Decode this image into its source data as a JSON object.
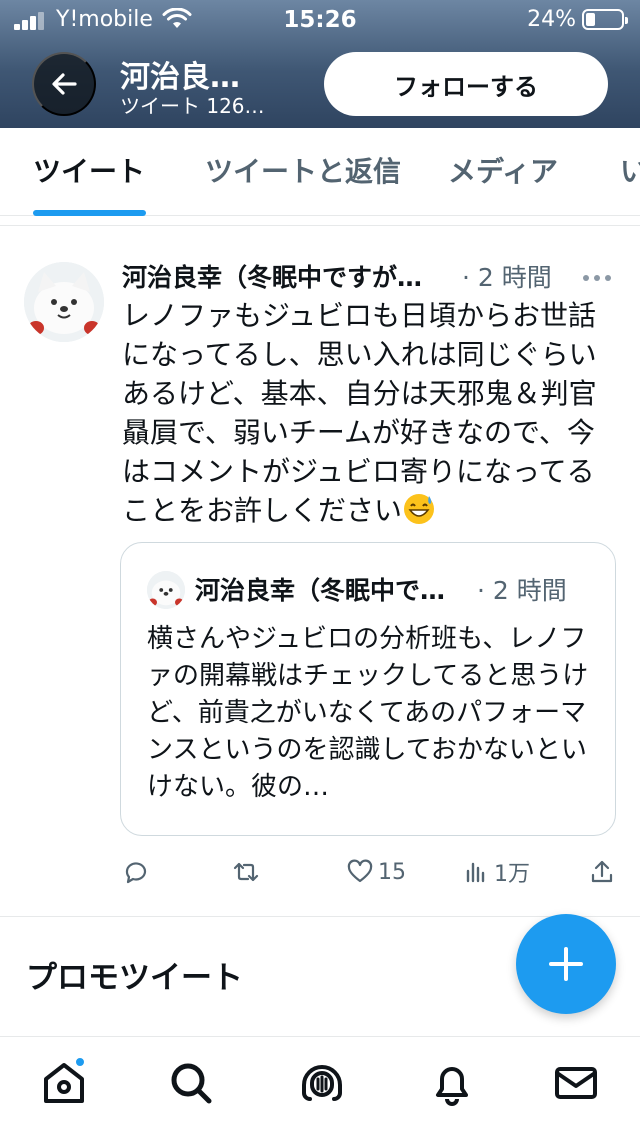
{
  "status_bar": {
    "carrier": "Y!mobile",
    "time": "15:26",
    "battery_pct": "24%"
  },
  "header": {
    "name": "河治良…",
    "subtitle": "ツイート 126…",
    "follow_label": "フォローする"
  },
  "tabs": [
    {
      "label": "ツイート"
    },
    {
      "label": "ツイートと返信"
    },
    {
      "label": "メディア"
    },
    {
      "label": "い"
    }
  ],
  "tweet": {
    "author": "河治良幸（冬眠中ですが…",
    "meta": "· 2 時間",
    "body": "レノファもジュビロも日頃からお世話になってるし、思い入れは同じぐらいあるけど、基本、自分は天邪鬼＆判官贔屓で、弱いチームが好きなので、今はコメントがジュビロ寄りになってることをお許しください",
    "quote": {
      "author": "河治良幸（冬眠中で…",
      "meta": "· 2 時間",
      "body": "横さんやジュビロの分析班も、レノファの開幕戦はチェックしてると思うけど、前貴之がいなくてあのパフォーマンスというのを認識しておかないといけない。彼の…"
    },
    "actions": {
      "likes": "15",
      "views": "1万"
    }
  },
  "promo_label": "プロモツイート",
  "colors": {
    "accent": "#1d9bf0",
    "text": "#0f1419",
    "muted": "#536471"
  }
}
